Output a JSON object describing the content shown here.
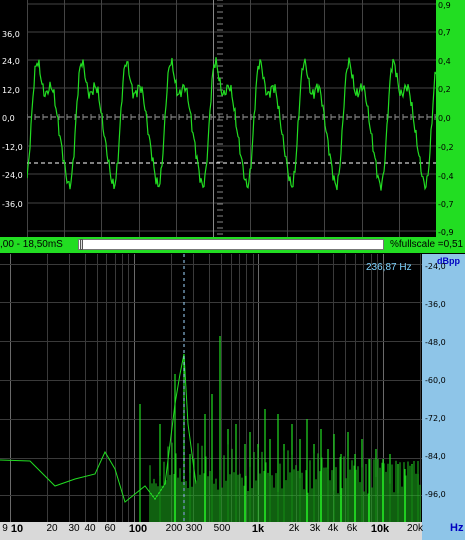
{
  "scope": {
    "left_ticks": [
      "36,0",
      "24,0",
      "12,0",
      "0,0",
      "-12,0",
      "-24,0",
      "-36,0"
    ],
    "right_ticks": [
      "0,9",
      "0,7",
      "0,4",
      "0,2",
      "0,0",
      "-0,2",
      "-0,4",
      "-0,7",
      "-0,9"
    ],
    "time_readout": ",00 - 18,50mS",
    "fullscale_readout": "%fullscale =0,51",
    "trace_color": "#22dd22"
  },
  "spectrum": {
    "db_unit": "dBpp",
    "db_ticks": [
      "-24,0",
      "-36,0",
      "-48,0",
      "-60,0",
      "-72,0",
      "-84,0",
      "-96,0"
    ],
    "cursor_freq": "236,87 Hz",
    "hz_unit": "Hz",
    "freq_labels": [
      {
        "text": "9",
        "bold": false
      },
      {
        "text": "10",
        "bold": true
      },
      {
        "text": "20",
        "bold": false
      },
      {
        "text": "30",
        "bold": false
      },
      {
        "text": "40",
        "bold": false
      },
      {
        "text": "60",
        "bold": false
      },
      {
        "text": "100",
        "bold": true
      },
      {
        "text": "200",
        "bold": false
      },
      {
        "text": "300",
        "bold": false
      },
      {
        "text": "500",
        "bold": false
      },
      {
        "text": "1k",
        "bold": true
      },
      {
        "text": "2k",
        "bold": false
      },
      {
        "text": "3k",
        "bold": false
      },
      {
        "text": "4k",
        "bold": false
      },
      {
        "text": "6k",
        "bold": false
      },
      {
        "text": "10k",
        "bold": true
      },
      {
        "text": "20k",
        "bold": false
      }
    ],
    "trace_color": "#22dd22",
    "cursor_color": "#9fd8ff"
  }
}
